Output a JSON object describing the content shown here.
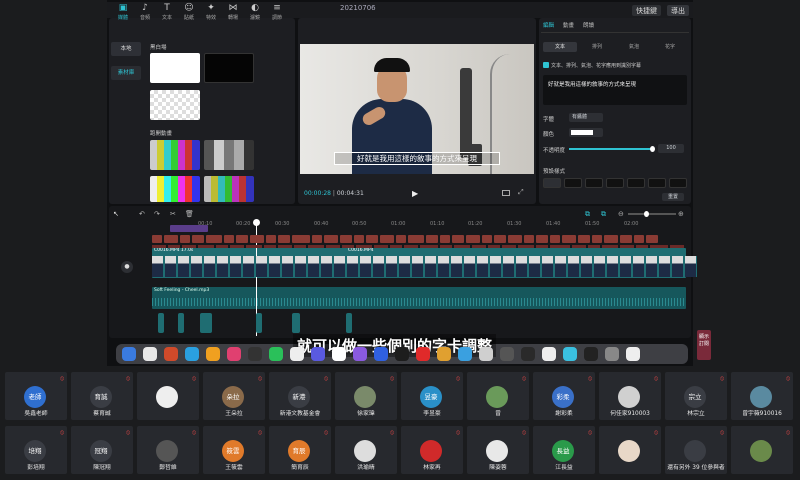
{
  "window": {
    "title": "20210706",
    "share_btn": "快捷鍵",
    "export_btn": "導出"
  },
  "media": {
    "tabs": [
      {
        "label": "媒體",
        "icon": "media-icon"
      },
      {
        "label": "音頻",
        "icon": "audio-icon"
      },
      {
        "label": "文本",
        "icon": "text-icon"
      },
      {
        "label": "貼紙",
        "icon": "sticker-icon"
      },
      {
        "label": "特效",
        "icon": "effects-icon"
      },
      {
        "label": "轉場",
        "icon": "transition-icon"
      },
      {
        "label": "濾鏡",
        "icon": "filter-icon"
      },
      {
        "label": "調節",
        "icon": "adjust-icon"
      }
    ],
    "nav": [
      "本地",
      "素材庫"
    ],
    "group1": "黑白場",
    "group2": "跑開動畫"
  },
  "preview": {
    "subtitle": "好就是我用這樣的敘事的方式來呈現",
    "time_current": "00:00:28",
    "time_total": "00:04:31"
  },
  "props": {
    "tabs": [
      "編輯",
      "動畫",
      "朗讀"
    ],
    "subtabs": [
      "文本",
      "排列",
      "氣泡",
      "花字"
    ],
    "checkbox_label": "文本、排列、氣泡、花字應用到識別字幕",
    "text_value": "好就是我用這樣的敘事的方式來呈現",
    "font_label": "字體",
    "font_value": "有醬體",
    "color_label": "顏色",
    "opacity_label": "不透明度",
    "opacity_value": "100",
    "preset_label": "預設樣式",
    "reset_btn": "重置"
  },
  "timeline": {
    "ticks": [
      "00:10",
      "00:20",
      "00:30",
      "00:40",
      "00:50",
      "01:00",
      "01:10",
      "01:20",
      "01:30",
      "01:40",
      "01:50",
      "02:00"
    ],
    "video_clip": "C0016.MP4  17.0s",
    "video_clip2": "C0016.MP4",
    "audio_clip": "Soft Feeling - Cheel.mp3"
  },
  "caption": "就可以做一些個別的字卡調整",
  "dock_right": "顯示 訂閱",
  "participants_row1": [
    {
      "name": "吳鑫老師",
      "avatar": "老師",
      "color": "#2f6fd0"
    },
    {
      "name": "蔡育誠",
      "avatar": "育誠",
      "color": "#3a3d44"
    },
    {
      "name": "",
      "avatar": "",
      "color": "#eee"
    },
    {
      "name": "王朵拉",
      "avatar": "朵拉",
      "color": "#8a6a4a"
    },
    {
      "name": "新港文教基金會",
      "avatar": "新港",
      "color": "#3a3d44"
    },
    {
      "name": "徐家瑋",
      "avatar": "",
      "color": "#7a8a6a"
    },
    {
      "name": "李昱豪",
      "avatar": "昱豪",
      "color": "#2a90c8"
    },
    {
      "name": "曾",
      "avatar": "",
      "color": "#6a9a5a"
    },
    {
      "name": "謝彩柔",
      "avatar": "彩柔",
      "color": "#3a70c8"
    },
    {
      "name": "何佳家910003",
      "avatar": "",
      "color": "#d0d0d0"
    },
    {
      "name": "林宗立",
      "avatar": "宗立",
      "color": "#3a3d44"
    },
    {
      "name": "曾宇薇910016",
      "avatar": "",
      "color": "#5a8aa0"
    }
  ],
  "participants_row2": [
    {
      "name": "彭培翔",
      "avatar": "培翔",
      "color": "#3a3d44"
    },
    {
      "name": "陳冠翔",
      "avatar": "冠翔",
      "color": "#3a3d44"
    },
    {
      "name": "鄭哲維",
      "avatar": "",
      "color": "#555"
    },
    {
      "name": "王筱雲",
      "avatar": "筱雲",
      "color": "#e07a2a"
    },
    {
      "name": "簡育辰",
      "avatar": "育辰",
      "color": "#e07a2a"
    },
    {
      "name": "洪瑜晴",
      "avatar": "",
      "color": "#ddd"
    },
    {
      "name": "林家再",
      "avatar": "",
      "color": "#d02a2a"
    },
    {
      "name": "陳姿蓉",
      "avatar": "",
      "color": "#e8e8e8"
    },
    {
      "name": "江長益",
      "avatar": "長益",
      "color": "#2a9a4a"
    },
    {
      "name": "",
      "avatar": "",
      "color": "#e8d8c8"
    },
    {
      "name": "還有另外 39 位參與者",
      "avatar": "",
      "color": "#3a3d44"
    },
    {
      "name": "",
      "avatar": "",
      "color": "#6a8a4a"
    }
  ]
}
